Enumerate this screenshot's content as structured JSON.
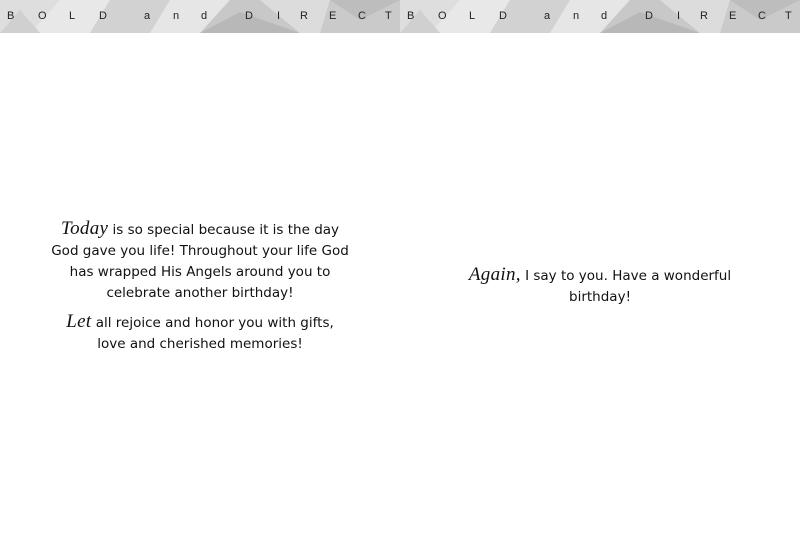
{
  "banner": {
    "left_letters": [
      "B",
      "O",
      "L",
      "D",
      "a",
      "n",
      "d",
      "D",
      "I",
      "R",
      "E",
      "C",
      "T"
    ],
    "right_letters": [
      "B",
      "O",
      "L",
      "D",
      "a",
      "n",
      "d",
      "D",
      "I",
      "R",
      "E",
      "C",
      "T"
    ]
  },
  "left_page": {
    "paragraph1": {
      "lead": "Today",
      "text": " is so special because it is the day God gave you life!  Throughout your life God has wrapped His Angels around you to celebrate another birthday!"
    },
    "paragraph2": {
      "lead": "Let",
      "text": " all rejoice and honor you with gifts, love and cherished memories!"
    }
  },
  "right_page": {
    "paragraph1": {
      "lead": "Again,",
      "text": " I say to you.  Have a wonderful birthday!"
    }
  },
  "colors": {
    "banner_light": "#e4e4e4",
    "banner_mid": "#cfcfcf",
    "banner_dark": "#b9b9b9",
    "text": "#111111"
  }
}
